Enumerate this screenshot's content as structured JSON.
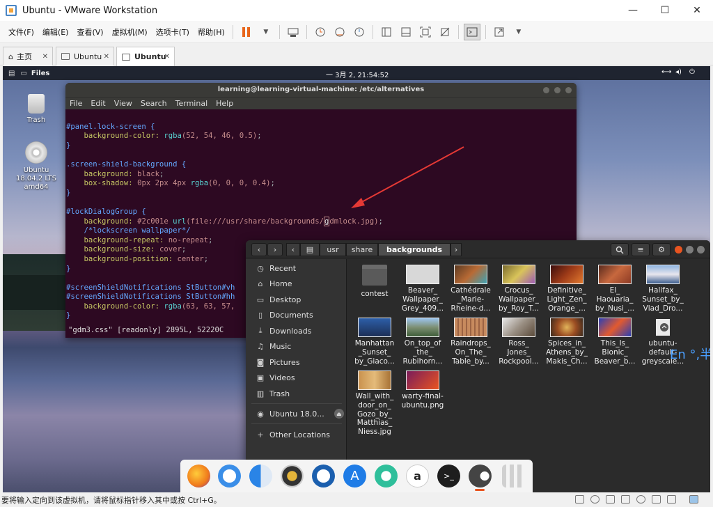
{
  "window": {
    "title": "Ubuntu - VMware Workstation",
    "minimize": "—",
    "maximize": "☐",
    "close": "✕"
  },
  "menu": [
    "文件(F)",
    "编辑(E)",
    "查看(V)",
    "虚拟机(M)",
    "选项卡(T)",
    "帮助(H)"
  ],
  "tabs": [
    {
      "label": "主页"
    },
    {
      "label": "Ubuntu"
    },
    {
      "label": "Ubuntu"
    }
  ],
  "guest_topbar": {
    "app": "Files",
    "clock": "一 3月  2, 21:54:52"
  },
  "desktop": {
    "trash": "Trash",
    "dvd": [
      "Ubuntu",
      "18.04.2 LTS",
      "amd64"
    ]
  },
  "terminal": {
    "title": "learning@learning-virtual-machine: /etc/alternatives",
    "menu": [
      "File",
      "Edit",
      "View",
      "Search",
      "Terminal",
      "Help"
    ],
    "status": "\"gdm3.css\" [readonly] 2895L, 52220C"
  },
  "files": {
    "crumbs": [
      "usr",
      "share",
      "backgrounds"
    ],
    "sidebar": [
      "Recent",
      "Home",
      "Desktop",
      "Documents",
      "Downloads",
      "Music",
      "Pictures",
      "Videos",
      "Trash",
      "Ubuntu 18.0...",
      "Other Locations"
    ],
    "items": [
      "contest",
      "Beaver_\nWallpaper_\nGrey_409...",
      "Cathédrale\n_Marie-\nRheine-d...",
      "Crocus_\nWallpaper_\nby_Roy_T...",
      "Definitive_\nLight_Zen_\nOrange_...",
      "El_\nHaouaria_\nby_Nusi_...",
      "Halifax_\nSunset_by_\nVlad_Dro...",
      "Manhattan\n_Sunset_\nby_Giaco...",
      "On_top_of\n_the_\nRubihorn...",
      "Raindrops_\nOn_The_\nTable_by...",
      "Ross_\nJones_\nRockpool...",
      "Spices_in_\nAthens_by_\nMakis_Ch...",
      "This_Is_\nBionic_\nBeaver_b...",
      "ubuntu-\ndefault-\ngreyscale...",
      "Wall_with_\ndoor_on_\nGozo_by_\nMatthias_\nNiess.jpg",
      "warty-final-\nubuntu.png"
    ]
  },
  "ime": {
    "label": "En °,半"
  },
  "statusbar": {
    "text": "要将输入定向到该虚拟机，请将鼠标指针移入其中或按 Ctrl+G。"
  },
  "colors": {
    "terminal_bg": "#2d0922",
    "files_bg": "#2b2b2b",
    "accent_orange": "#e95420",
    "arrow_red": "#e53935"
  }
}
